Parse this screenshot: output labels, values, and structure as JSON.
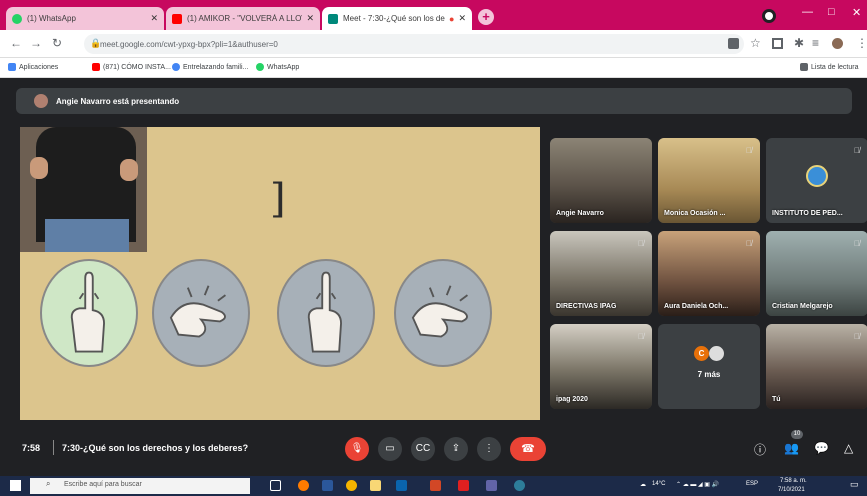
{
  "browser": {
    "tabs": [
      {
        "title": "(1) WhatsApp",
        "state": "inactive",
        "icon": "whatsapp-icon",
        "icon_color": "#25d366"
      },
      {
        "title": "(1) AMIKOR - \"VOLVERÁ A LLOV",
        "state": "inactive",
        "icon": "youtube-icon",
        "icon_color": "#ff0000"
      },
      {
        "title": "Meet - 7:30-¿Qué son los de",
        "state": "active",
        "icon": "meet-icon",
        "icon_color": "#00897b"
      }
    ],
    "url": "meet.google.com/cwt-ypxg-bpx?pli=1&authuser=0",
    "bookmarks": [
      {
        "label": "Aplicaciones",
        "icon": "apps-grid-icon",
        "color": "#4285f4"
      },
      {
        "label": "(871) CÓMO INSTA...",
        "icon": "youtube-icon",
        "color": "#ff0000"
      },
      {
        "label": "Entrelazando famili...",
        "icon": "google-icon",
        "color": "#4285f4"
      },
      {
        "label": "WhatsApp",
        "icon": "whatsapp-icon",
        "color": "#25d366"
      }
    ],
    "reading_list": "Lista de lectura",
    "accent_color": "#c7085f"
  },
  "meet": {
    "presenting_banner": "Angie Navarro está presentando",
    "participants": [
      {
        "name": "Angie Navarro",
        "muted": false
      },
      {
        "name": "Monica Ocasión ...",
        "muted": true
      },
      {
        "name": "INSTITUTO DE PED...",
        "muted": true
      },
      {
        "name": "DIRECTIVAS IPAG",
        "muted": true
      },
      {
        "name": "Aura Daniela Och...",
        "muted": true
      },
      {
        "name": "Cristian Melgarejo",
        "muted": true
      },
      {
        "name": "ipag 2020",
        "muted": true
      },
      {
        "name": "7 más",
        "muted": false
      },
      {
        "name": "Tú",
        "muted": true
      }
    ],
    "more_avatar_letter": "C",
    "time": "7:58",
    "meeting_title": "7:30-¿Qué son los derechos y los deberes?",
    "participant_count": "10"
  },
  "taskbar": {
    "search_placeholder": "Escribe aquí para buscar",
    "weather": "14°C",
    "language": "ESP",
    "time": "7:58 a. m.",
    "date": "7/10/2021"
  }
}
